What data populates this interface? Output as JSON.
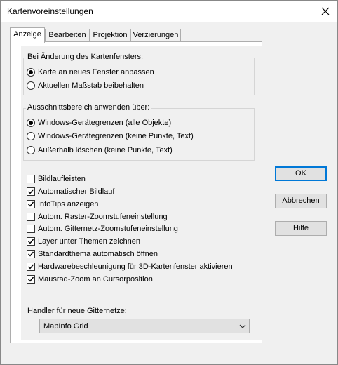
{
  "window": {
    "title": "Kartenvoreinstellungen"
  },
  "tabs": [
    {
      "label": "Anzeige",
      "active": true
    },
    {
      "label": "Bearbeiten",
      "active": false
    },
    {
      "label": "Projektion",
      "active": false
    },
    {
      "label": "Verzierungen",
      "active": false
    }
  ],
  "group1": {
    "label": "Bei Änderung des Kartenfensters:",
    "options": [
      {
        "label": "Karte an neues Fenster anpassen",
        "checked": true
      },
      {
        "label": "Aktuellen Maßstab beibehalten",
        "checked": false
      }
    ]
  },
  "group2": {
    "label": "Ausschnittsbereich anwenden über:",
    "options": [
      {
        "label": "Windows-Gerätegrenzen (alle Objekte)",
        "checked": true
      },
      {
        "label": "Windows-Gerätegrenzen (keine Punkte, Text)",
        "checked": false
      },
      {
        "label": "Außerhalb löschen (keine Punkte, Text)",
        "checked": false
      }
    ]
  },
  "checkboxes": [
    {
      "label": "Bildlaufleisten",
      "checked": false
    },
    {
      "label": "Automatischer Bildlauf",
      "checked": true
    },
    {
      "label": "InfoTips anzeigen",
      "checked": true
    },
    {
      "label": "Autom. Raster-Zoomstufeneinstellung",
      "checked": false
    },
    {
      "label": "Autom. Gitternetz-Zoomstufeneinstellung",
      "checked": false
    },
    {
      "label": "Layer unter Themen zeichnen",
      "checked": true
    },
    {
      "label": "Standardthema automatisch öffnen",
      "checked": true
    },
    {
      "label": "Hardwarebeschleunigung für 3D-Kartenfenster aktivieren",
      "checked": true
    },
    {
      "label": "Mausrad-Zoom an Cursorposition",
      "checked": true
    }
  ],
  "handler": {
    "label": "Handler für neue Gitternetze:",
    "value": "MapInfo Grid"
  },
  "buttons": {
    "ok": "OK",
    "cancel": "Abbrechen",
    "help": "Hilfe"
  },
  "colors": {
    "focus_border": "#0078d7"
  }
}
